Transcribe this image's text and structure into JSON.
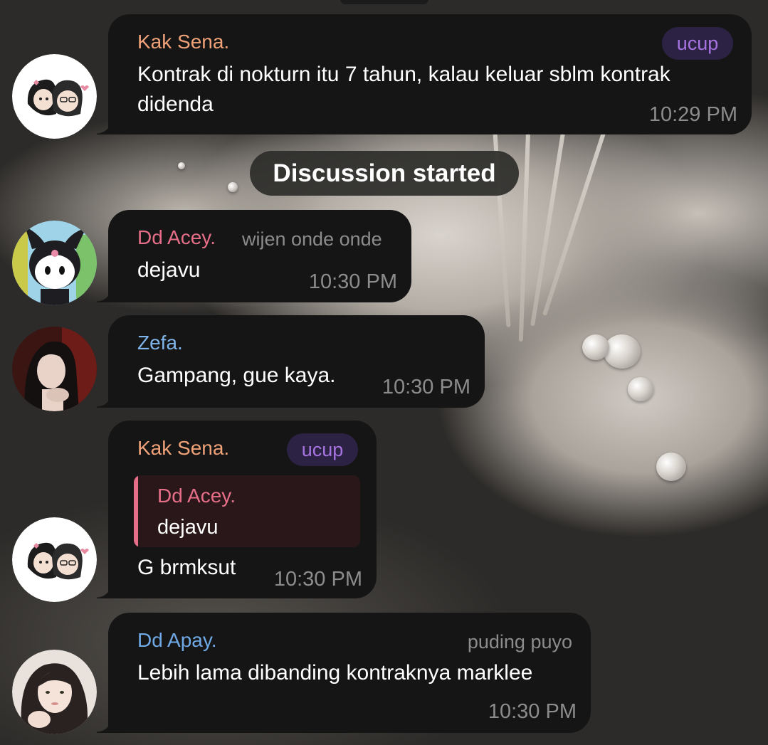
{
  "colors": {
    "bubble": "#151515",
    "kak_sena": "#f0a279",
    "dd_acey": "#e56e88",
    "zefa": "#7fb5ea",
    "dd_apay": "#6fa9e6",
    "time": "#8c8c8c",
    "badge_bg": "#2c2244",
    "badge_text": "#a673e0"
  },
  "messages": [
    {
      "sender": "Kak Sena.",
      "badge": "ucup",
      "text_line1": "Kontrak di nokturn itu 7 tahun, kalau keluar sblm kontrak",
      "text_line2": "didenda",
      "time": "10:29 PM",
      "avatar_icon": "couple-sticker-avatar"
    },
    {
      "sender": "Dd Acey.",
      "role": "wijen onde onde",
      "text": "dejavu",
      "time": "10:30 PM",
      "avatar_icon": "kuromi-avatar"
    },
    {
      "sender": "Zefa.",
      "text": "Gampang, gue kaya.",
      "time": "10:30 PM",
      "avatar_icon": "portrait-photo-avatar"
    },
    {
      "sender": "Kak Sena.",
      "badge": "ucup",
      "reply_sender": "Dd Acey.",
      "reply_text": "dejavu",
      "text": "G brmksut",
      "time": "10:30 PM",
      "avatar_icon": "couple-sticker-avatar"
    },
    {
      "sender": "Dd Apay.",
      "role": "puding puyo",
      "text": "Lebih lama dibanding kontraknya marklee",
      "time": "10:30 PM",
      "avatar_icon": "selfie-photo-avatar"
    }
  ],
  "service_message": "Discussion started"
}
